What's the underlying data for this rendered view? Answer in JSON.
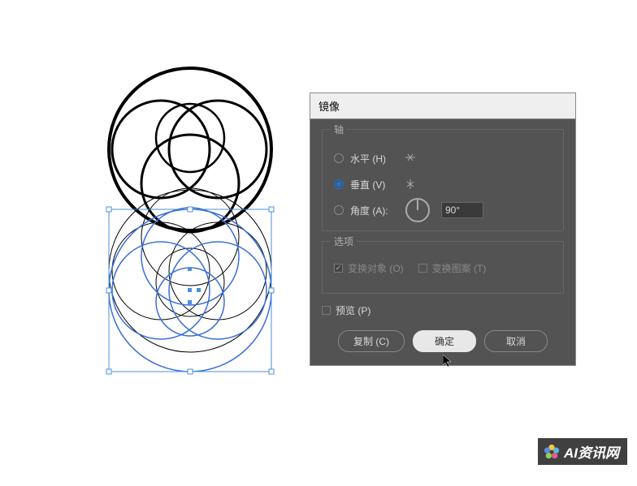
{
  "dialog": {
    "title": "镜像",
    "axis": {
      "label": "轴",
      "horizontal": "水平 (H)",
      "vertical": "垂直 (V)",
      "angle": "角度 (A):",
      "angle_value": "90°",
      "selected": "vertical"
    },
    "options": {
      "label": "选项",
      "transform_objects": "变换对象 (O)",
      "transform_patterns": "变换图案 (T)"
    },
    "preview": "预览 (P)",
    "buttons": {
      "copy": "复制 (C)",
      "ok": "确定",
      "cancel": "取消"
    }
  },
  "watermark": "AI资讯网"
}
